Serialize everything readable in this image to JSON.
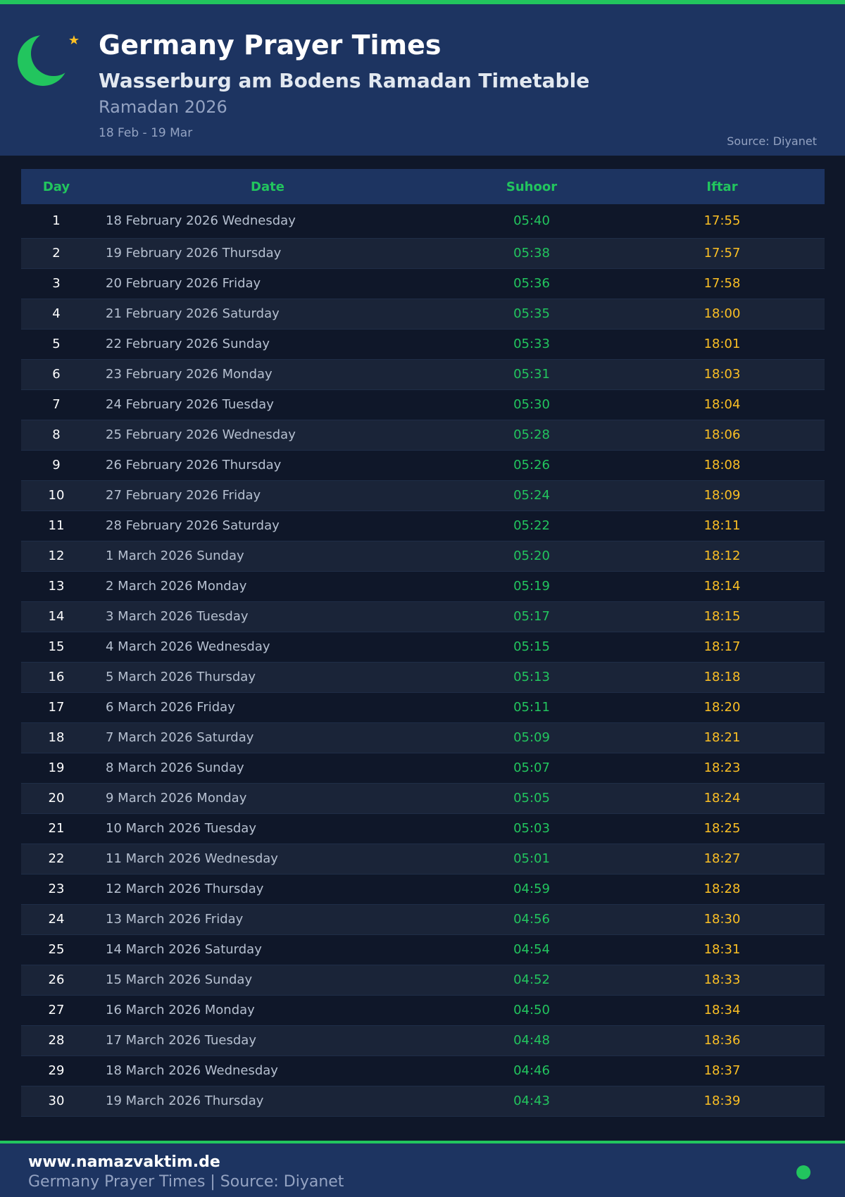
{
  "header": {
    "title": "Germany Prayer Times",
    "subtitle": "Wasserburg am Bodens Ramadan Timetable",
    "period": "Ramadan 2026",
    "range": "18 Feb - 19 Mar",
    "source": "Source: Diyanet"
  },
  "table": {
    "columns": [
      "Day",
      "Date",
      "Suhoor",
      "Iftar"
    ],
    "rows": [
      {
        "day": "1",
        "date": "18 February 2026 Wednesday",
        "suhoor": "05:40",
        "iftar": "17:55"
      },
      {
        "day": "2",
        "date": "19 February 2026 Thursday",
        "suhoor": "05:38",
        "iftar": "17:57"
      },
      {
        "day": "3",
        "date": "20 February 2026 Friday",
        "suhoor": "05:36",
        "iftar": "17:58"
      },
      {
        "day": "4",
        "date": "21 February 2026 Saturday",
        "suhoor": "05:35",
        "iftar": "18:00"
      },
      {
        "day": "5",
        "date": "22 February 2026 Sunday",
        "suhoor": "05:33",
        "iftar": "18:01"
      },
      {
        "day": "6",
        "date": "23 February 2026 Monday",
        "suhoor": "05:31",
        "iftar": "18:03"
      },
      {
        "day": "7",
        "date": "24 February 2026 Tuesday",
        "suhoor": "05:30",
        "iftar": "18:04"
      },
      {
        "day": "8",
        "date": "25 February 2026 Wednesday",
        "suhoor": "05:28",
        "iftar": "18:06"
      },
      {
        "day": "9",
        "date": "26 February 2026 Thursday",
        "suhoor": "05:26",
        "iftar": "18:08"
      },
      {
        "day": "10",
        "date": "27 February 2026 Friday",
        "suhoor": "05:24",
        "iftar": "18:09"
      },
      {
        "day": "11",
        "date": "28 February 2026 Saturday",
        "suhoor": "05:22",
        "iftar": "18:11"
      },
      {
        "day": "12",
        "date": "1 March 2026 Sunday",
        "suhoor": "05:20",
        "iftar": "18:12"
      },
      {
        "day": "13",
        "date": "2 March 2026 Monday",
        "suhoor": "05:19",
        "iftar": "18:14"
      },
      {
        "day": "14",
        "date": "3 March 2026 Tuesday",
        "suhoor": "05:17",
        "iftar": "18:15"
      },
      {
        "day": "15",
        "date": "4 March 2026 Wednesday",
        "suhoor": "05:15",
        "iftar": "18:17"
      },
      {
        "day": "16",
        "date": "5 March 2026 Thursday",
        "suhoor": "05:13",
        "iftar": "18:18"
      },
      {
        "day": "17",
        "date": "6 March 2026 Friday",
        "suhoor": "05:11",
        "iftar": "18:20"
      },
      {
        "day": "18",
        "date": "7 March 2026 Saturday",
        "suhoor": "05:09",
        "iftar": "18:21"
      },
      {
        "day": "19",
        "date": "8 March 2026 Sunday",
        "suhoor": "05:07",
        "iftar": "18:23"
      },
      {
        "day": "20",
        "date": "9 March 2026 Monday",
        "suhoor": "05:05",
        "iftar": "18:24"
      },
      {
        "day": "21",
        "date": "10 March 2026 Tuesday",
        "suhoor": "05:03",
        "iftar": "18:25"
      },
      {
        "day": "22",
        "date": "11 March 2026 Wednesday",
        "suhoor": "05:01",
        "iftar": "18:27"
      },
      {
        "day": "23",
        "date": "12 March 2026 Thursday",
        "suhoor": "04:59",
        "iftar": "18:28"
      },
      {
        "day": "24",
        "date": "13 March 2026 Friday",
        "suhoor": "04:56",
        "iftar": "18:30"
      },
      {
        "day": "25",
        "date": "14 March 2026 Saturday",
        "suhoor": "04:54",
        "iftar": "18:31"
      },
      {
        "day": "26",
        "date": "15 March 2026 Sunday",
        "suhoor": "04:52",
        "iftar": "18:33"
      },
      {
        "day": "27",
        "date": "16 March 2026 Monday",
        "suhoor": "04:50",
        "iftar": "18:34"
      },
      {
        "day": "28",
        "date": "17 March 2026 Tuesday",
        "suhoor": "04:48",
        "iftar": "18:36"
      },
      {
        "day": "29",
        "date": "18 March 2026 Wednesday",
        "suhoor": "04:46",
        "iftar": "18:37"
      },
      {
        "day": "30",
        "date": "19 March 2026 Thursday",
        "suhoor": "04:43",
        "iftar": "18:39"
      }
    ]
  },
  "footer": {
    "site": "www.namazvaktim.de",
    "subtitle": "Germany Prayer Times | Source: Diyanet"
  },
  "icons": {
    "logo": "crescent-moon-star-icon",
    "footer_dot": "status-dot-icon"
  },
  "colors": {
    "accent": "#22c55e",
    "iftar": "#fbbf24",
    "header_bg": "#1d3461",
    "page_bg": "#0f1729"
  }
}
